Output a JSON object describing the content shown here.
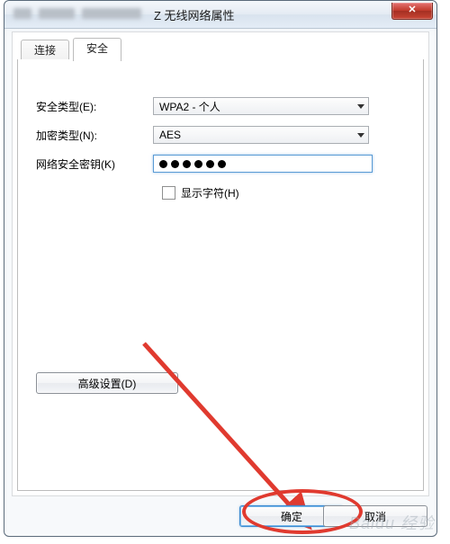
{
  "window": {
    "title_suffix": "Z 无线网络属性",
    "close_glyph": "✕"
  },
  "tabs": {
    "connect": "连接",
    "security": "安全"
  },
  "security_panel": {
    "sec_type_label": "安全类型(E):",
    "sec_type_value": "WPA2 - 个人",
    "enc_type_label": "加密类型(N):",
    "enc_type_value": "AES",
    "net_key_label": "网络安全密钥(K)",
    "net_key_mask_count": 6,
    "show_chars_label": "显示字符(H)",
    "advanced_label": "高级设置(D)"
  },
  "buttons": {
    "ok": "确定",
    "cancel": "取消"
  },
  "annotation": {
    "arrow_color": "#e03a2f"
  },
  "watermark": "Baidu 经验"
}
